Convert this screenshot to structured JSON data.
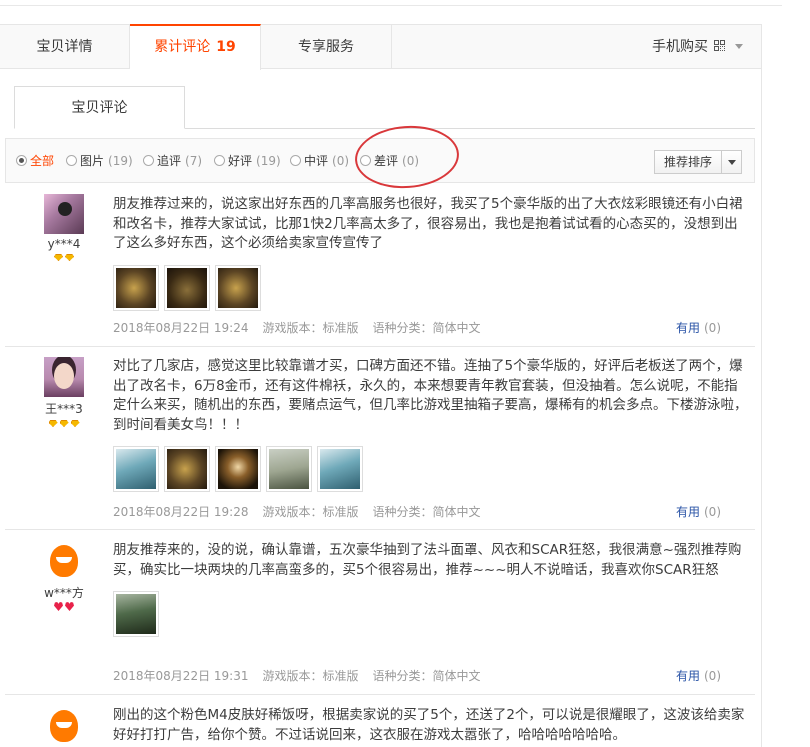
{
  "tabs": {
    "details": "宝贝详情",
    "reviews": "累计评论",
    "reviews_count": "19",
    "service": "专享服务",
    "mobile_buy": "手机购买"
  },
  "subtab": "宝贝评论",
  "filters": [
    {
      "label": "全部",
      "count": "",
      "selected": true
    },
    {
      "label": "图片",
      "count": "(19)"
    },
    {
      "label": "追评",
      "count": "(7)"
    },
    {
      "label": "好评",
      "count": "(19)"
    },
    {
      "label": "中评",
      "count": "(0)"
    },
    {
      "label": "差评",
      "count": "(0)"
    }
  ],
  "sort_button": "推荐排序",
  "icons": {
    "qr": "qr-code-icon",
    "caret": "chevron-down-icon",
    "level_gem": "diamond-icon",
    "level_heart": "heart-icon"
  },
  "colors": {
    "accent": "#ff4400",
    "annotation_circle": "#d9383b",
    "useful_link": "#2953a6"
  },
  "reviews": [
    {
      "user": "y***4",
      "level_icons": 2,
      "text": "朋友推荐过来的，说这家出好东西的几率高服务也很好，我买了5个豪华版的出了大衣炫彩眼镜还有小白裙和改名卡，推荐大家试试，比那1快2几率高太多了，很容易出，我也是抱着试试看的心态买的，没想到出了这么多好东西，这个必须给卖家宣传宣传了",
      "photos": 3,
      "date": "2018年08月22日 19:24",
      "version": "游戏版本：标准版",
      "lang": "语种分类：简体中文",
      "useful": "有用",
      "useful_count": "(0)"
    },
    {
      "user": "王***3",
      "level_icons": 3,
      "text": "对比了几家店，感觉这里比较靠谱才买，口碑方面还不错。连抽了5个豪华版的，好评后老板送了两个，爆出了改名卡，6万8金币，还有这件棉袄，永久的，本来想要青年教官套装，但没抽着。怎么说呢，不能指定什么来买，随机出的东西，要赌点运气，但几率比游戏里抽箱子要高，爆稀有的机会多点。下楼游泳啦，到时间看美女鸟！！！",
      "photos": 5,
      "date": "2018年08月22日 19:28",
      "version": "游戏版本：标准版",
      "lang": "语种分类：简体中文",
      "useful": "有用",
      "useful_count": "(0)"
    },
    {
      "user": "w***方",
      "level_icons": 2,
      "text": "朋友推荐来的，没的说，确认靠谱，五次豪华抽到了法斗面罩、风衣和SCAR狂怒，我很满意~强烈推荐购买，确实比一块两块的几率高蛮多的，买5个很容易出，推荐~~~明人不说暗话，我喜欢你SCAR狂怒",
      "photos": 1,
      "date": "2018年08月22日 19:31",
      "version": "游戏版本：标准版",
      "lang": "语种分类：简体中文",
      "useful": "有用",
      "useful_count": "(0)"
    },
    {
      "user": "",
      "text": "刚出的这个粉色M4皮肤好稀饭呀，根据卖家说的买了5个，还送了2个，可以说是很耀眼了，这波该给卖家好好打打广告，给你个赞。不过话说回来，这衣服在游戏太嚣张了，哈哈哈哈哈哈哈。"
    }
  ]
}
